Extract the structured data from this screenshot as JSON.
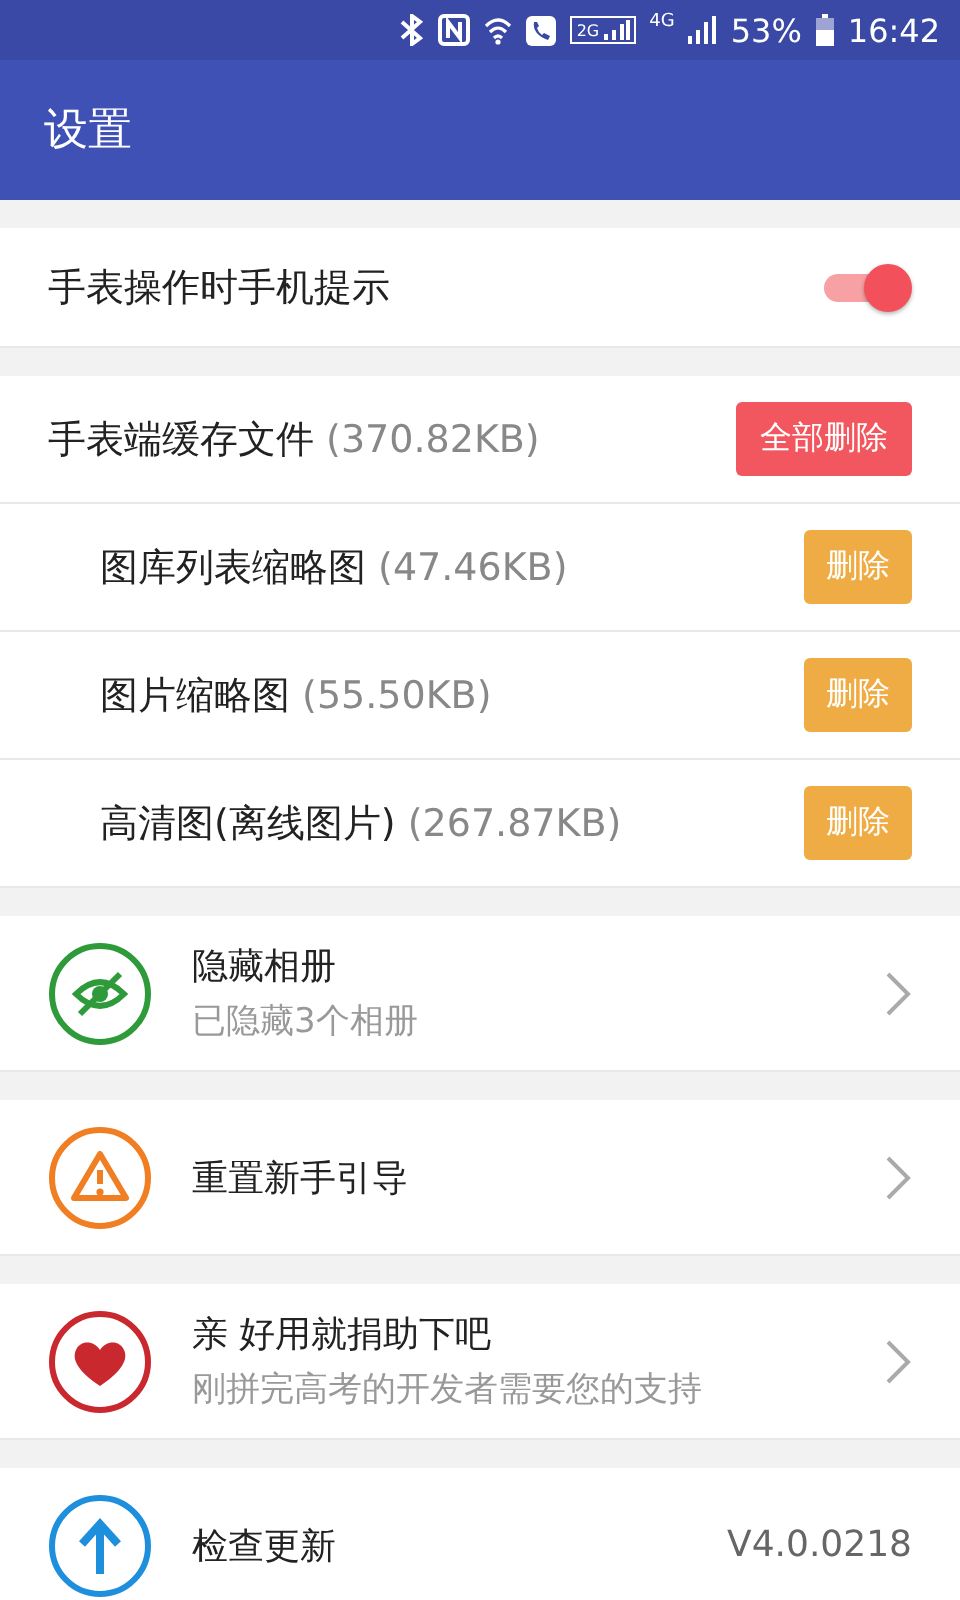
{
  "status_bar": {
    "sim_badge": "2G",
    "network": "4G",
    "battery": "53%",
    "time": "16:42"
  },
  "app_bar": {
    "title": "设置"
  },
  "toggle": {
    "label": "手表操作时手机提示",
    "on": true
  },
  "cache": {
    "label": "手表端缓存文件",
    "size": "(370.82KB)",
    "button": "全部删除",
    "items": [
      {
        "label": "图库列表缩略图",
        "size": "(47.46KB)",
        "button": "删除"
      },
      {
        "label": "图片缩略图",
        "size": "(55.50KB)",
        "button": "删除"
      },
      {
        "label": "高清图(离线图片)",
        "size": "(267.87KB)",
        "button": "删除"
      }
    ]
  },
  "menu": [
    {
      "kind": "eye-off",
      "color": "#2e9a3a",
      "title": "隐藏相册",
      "subtitle": "已隐藏3个相册",
      "chevron": true
    },
    {
      "kind": "warning",
      "color": "#f07f24",
      "title": "重置新手引导",
      "chevron": true
    },
    {
      "kind": "heart",
      "color": "#c9282e",
      "title": "亲 好用就捐助下吧",
      "subtitle": "刚拼完高考的开发者需要您的支持",
      "chevron": true
    },
    {
      "kind": "arrow-up",
      "color": "#1e8fdc",
      "title": "检查更新",
      "value": "V4.0.0218",
      "chevron": false
    }
  ]
}
